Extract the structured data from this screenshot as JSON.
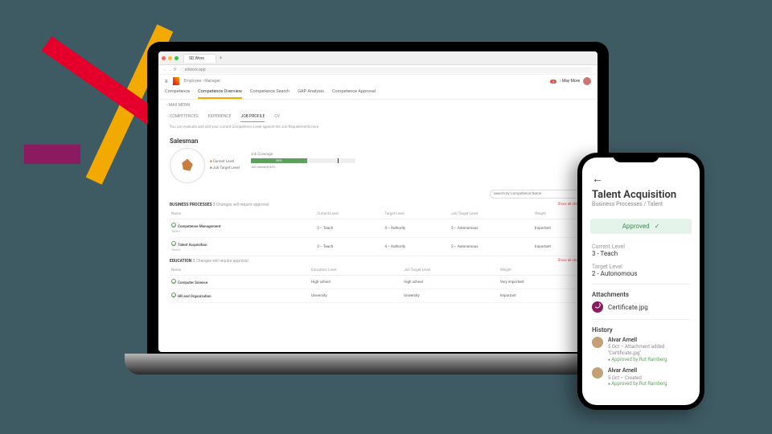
{
  "chrome": {
    "tab_title": "SD Worx",
    "url": "sdworx.app",
    "traffic": [
      "#ff5f57",
      "#febc2e",
      "#28c840"
    ]
  },
  "app": {
    "menu_icon": "≡",
    "breadcrumb": "Employee  ›  Manager",
    "user": {
      "badge": "3",
      "name": "› May More"
    },
    "tabs": [
      "Competence",
      "Competence Overview",
      "Competence Search",
      "GAP Analysis",
      "Competence Approval"
    ],
    "active_tab": 1,
    "back_link": "‹ MAX MENN",
    "subtabs": [
      "COMPETENCES",
      "EXPERIENCE",
      "JOB PROFILE",
      "CV"
    ],
    "active_subtab": 2,
    "hint": "You can evaluate and edit your current Competence Level against the Job Requirements here.",
    "job_title": "Salesman",
    "legend": {
      "a": "Current Level",
      "b": "Job Target Level"
    },
    "coverage": {
      "label": "Job Coverage",
      "value": "54%",
      "width": "54%",
      "demand": "Job demand 83%",
      "demand_pos": "83%"
    },
    "search_placeholder": "Search by Competence Name",
    "sections": [
      {
        "name": "BUSINESS PROCESSES",
        "count": "3",
        "note": "Changes will require approval",
        "showall": "Show all chapters",
        "cols": [
          "Name",
          "Current Level",
          "Target Level",
          "Job Target Level",
          "Weight"
        ],
        "rows": [
          {
            "name": "Competence Management",
            "sub": "Talent",
            "c1": "3 – Teach",
            "c2": "4 – Authority",
            "c3": "2 – Autonomous",
            "c4": "Important"
          },
          {
            "name": "Talent Acquisition",
            "sub": "Talent",
            "c1": "3 – Teach",
            "c2": "4 – Authority",
            "c3": "2 – Autonomous",
            "c4": "Important"
          }
        ]
      },
      {
        "name": "EDUCATION",
        "count": "3",
        "note": "Changes will require approval",
        "showall": "Show all chapters",
        "cols": [
          "Name",
          "Education Level",
          "Job Target Level",
          "Weight"
        ],
        "rows": [
          {
            "name": "Computer Science",
            "c1": "High school",
            "c2": "High school",
            "c3": "Very important"
          },
          {
            "name": "HR and Organization",
            "c1": "University",
            "c2": "University",
            "c3": "Important"
          }
        ]
      }
    ]
  },
  "phone": {
    "title": "Talent Acquisition",
    "subtitle": "Business Processes / Talent",
    "approved": "Approved",
    "current": {
      "label": "Current Level",
      "value": "3 - Teach"
    },
    "target": {
      "label": "Target Level",
      "value": "2 - Autonomous"
    },
    "attachments_label": "Attachments",
    "file": "Certificate.jpg",
    "history_label": "History",
    "history": [
      {
        "name": "Alvar Arnell",
        "meta": "5 Oct – Attachment added \"Certificate.jpg\"",
        "approved": "Approved by Rut Ramberg"
      },
      {
        "name": "Alvar Arnell",
        "meta": "5 Oct – Created",
        "approved": "Approved by Rut Ramberg"
      }
    ]
  }
}
